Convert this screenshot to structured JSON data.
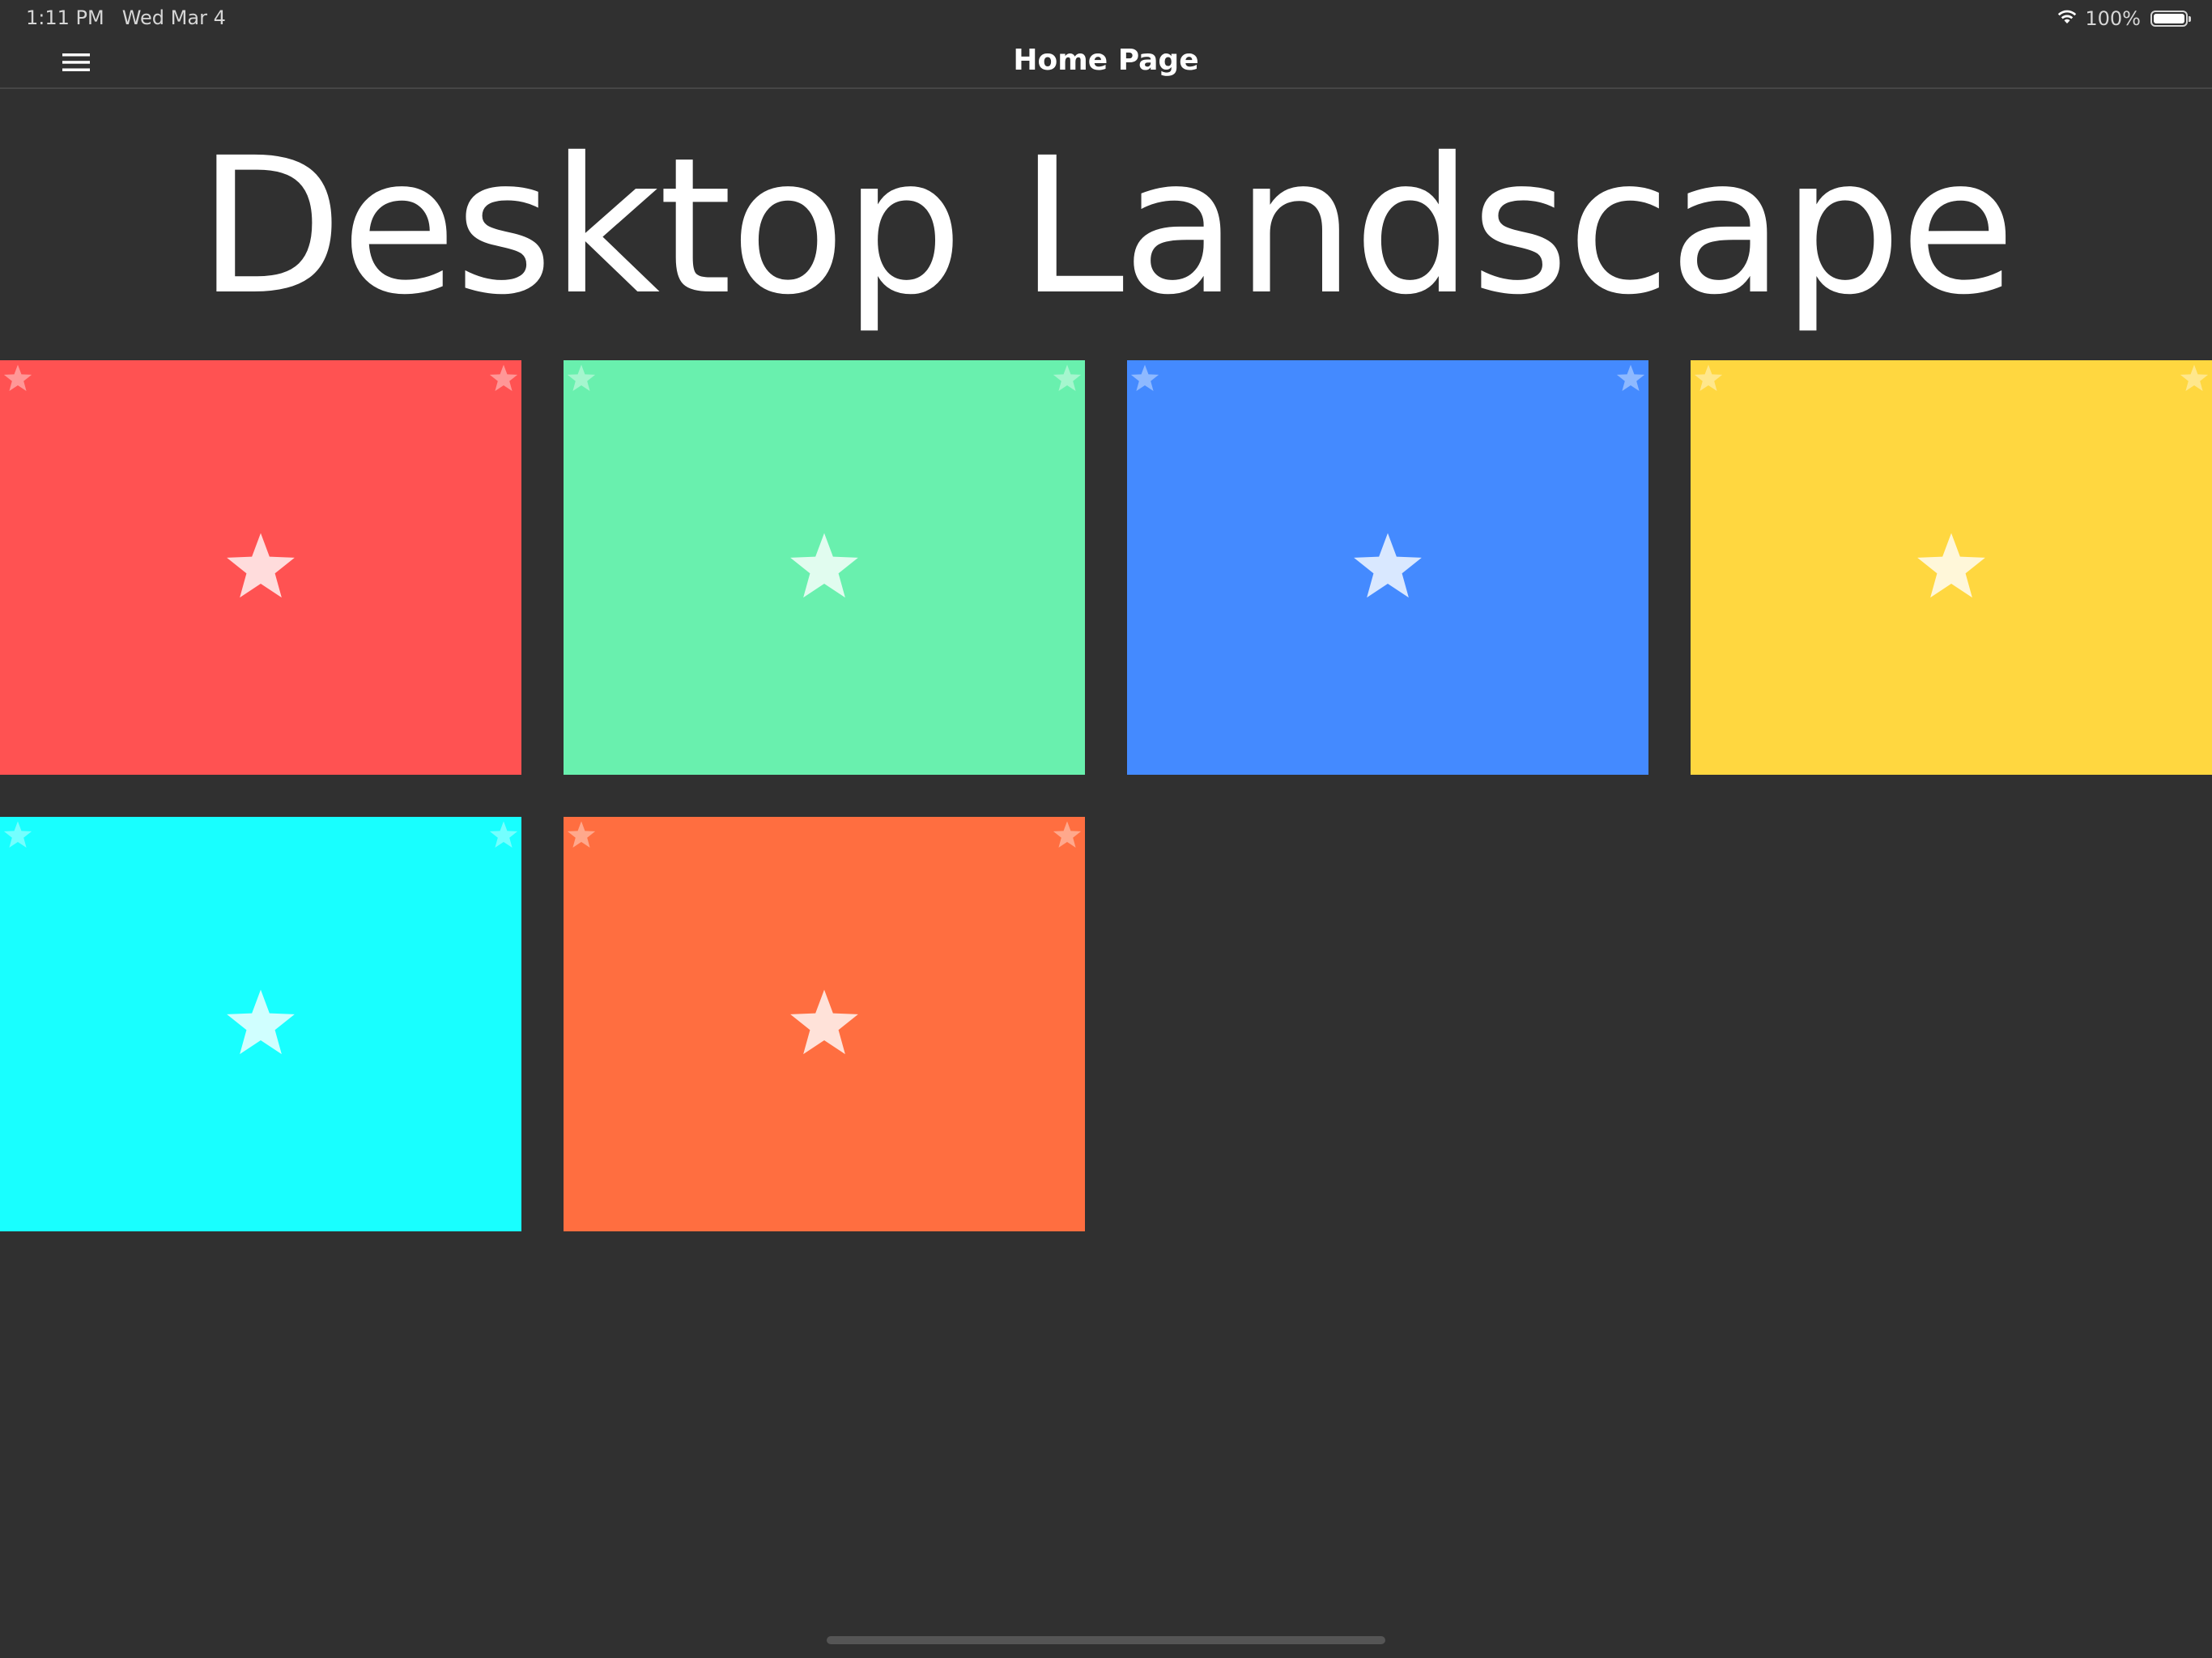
{
  "status_bar": {
    "time": "1:11 PM",
    "date": "Wed Mar 4",
    "battery": "100%",
    "icons": [
      "wifi-icon",
      "battery-icon"
    ]
  },
  "app_bar": {
    "title": "Home Page",
    "menu_icon": "hamburger-menu-icon"
  },
  "main": {
    "headline": "Desktop Landscape",
    "tiles": [
      {
        "color": "#ff5252",
        "icon": "star-icon"
      },
      {
        "color": "#69f0ae",
        "icon": "star-icon"
      },
      {
        "color": "#448aff",
        "icon": "star-icon"
      },
      {
        "color": "#ffd740",
        "icon": "star-icon"
      },
      {
        "color": "#18ffff",
        "icon": "star-icon"
      },
      {
        "color": "#ff6e40",
        "icon": "star-icon"
      }
    ]
  },
  "colors": {
    "background": "#303030",
    "text": "#ffffff"
  }
}
